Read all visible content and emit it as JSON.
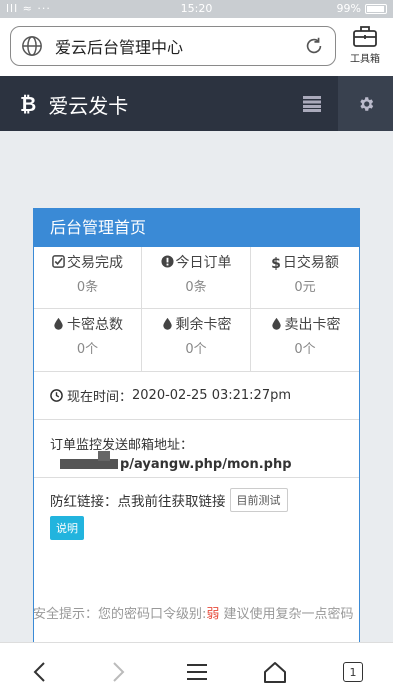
{
  "statusbar": {
    "left": "lll ≈ ···",
    "time": "15:20",
    "battery": "99%"
  },
  "browser": {
    "url_text": "爱云后台管理中心",
    "toolbox_label": "工具箱"
  },
  "header": {
    "brand": "爱云发卡",
    "brand_icon": "bitcoin-icon"
  },
  "panel": {
    "title": "后台管理首页",
    "stats": [
      {
        "label": "交易完成",
        "value": "0",
        "unit": "条",
        "icon": "check-square-icon"
      },
      {
        "label": "今日订单",
        "value": "0",
        "unit": "条",
        "icon": "exclamation-circle-icon"
      },
      {
        "label": "日交易额",
        "value": "0",
        "unit": "元",
        "icon": "dollar-icon"
      },
      {
        "label": "卡密总数",
        "value": "0",
        "unit": "个",
        "icon": "tint-icon"
      },
      {
        "label": "剩余卡密",
        "value": "0",
        "unit": "个",
        "icon": "tint-icon"
      },
      {
        "label": "卖出卡密",
        "value": "0",
        "unit": "个",
        "icon": "tint-icon"
      }
    ],
    "time_label": "现在时间：",
    "time_value": "2020-02-25 03:21:27pm",
    "mail_label": "订单监控发送邮箱地址：",
    "mail_url": "p/ayangw.php/mon.php",
    "hotlink_label": "防红链接：点我前往获取链接",
    "test_button": "目前测试",
    "info_button": "说明"
  },
  "warning": {
    "prefix": "安全提示：您的密码口令级别:",
    "level": "弱",
    "suffix": " 建议使用复杂一点密码"
  },
  "bottom": {
    "tab_count": "1"
  }
}
